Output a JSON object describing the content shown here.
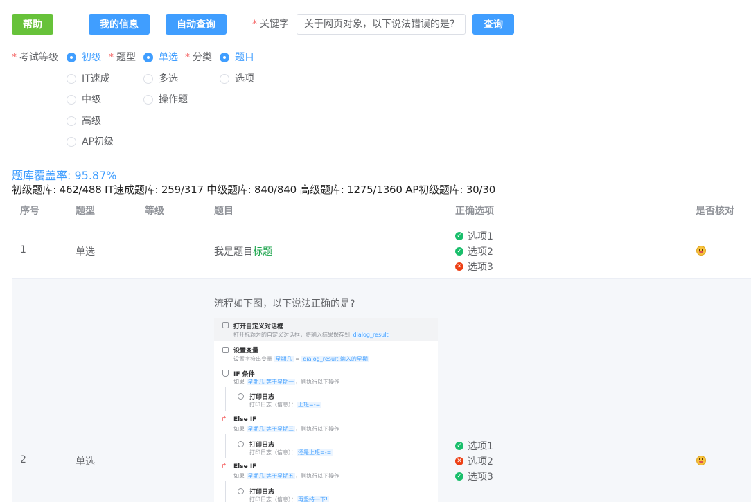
{
  "toolbar": {
    "help": "帮助",
    "my_info": "我的信息",
    "auto_query": "自动查询",
    "keyword_label": "关键字",
    "keyword_value": "关于网页对象，以下说法错误的是?",
    "query": "查询"
  },
  "filters": {
    "level_label": "考试等级",
    "levels": [
      "初级",
      "IT速成",
      "中级",
      "高级",
      "AP初级"
    ],
    "type_label": "题型",
    "types": [
      "单选",
      "多选",
      "操作题"
    ],
    "category_label": "分类",
    "categories": [
      "题目",
      "选项"
    ]
  },
  "coverage": "题库覆盖率: 95.87%",
  "stats": "初级题库: 462/488 IT速成题库: 259/317 中级题库: 840/840 高级题库: 1275/1360 AP初级题库: 30/30",
  "table": {
    "headers": [
      "序号",
      "题型",
      "等级",
      "题目",
      "正确选项",
      "是否核对"
    ],
    "rows": [
      {
        "index": "1",
        "type": "单选",
        "level": "",
        "question_prefix": "我是题目",
        "question_highlight": "标题",
        "options": [
          {
            "label": "选项1",
            "status": "correct"
          },
          {
            "label": "选项2",
            "status": "correct"
          },
          {
            "label": "选项3",
            "status": "wrong"
          }
        ]
      },
      {
        "index": "2",
        "type": "单选",
        "level": "",
        "question": "流程如下图，以下说法正确的是?",
        "options": [
          {
            "label": "选项1",
            "status": "correct"
          },
          {
            "label": "选项2",
            "status": "wrong"
          },
          {
            "label": "选项3",
            "status": "correct"
          }
        ],
        "flow": {
          "b1_title": "打开自定义对话框",
          "b1_sub": "打开标题为的自定义对话框，将输入结果保存到",
          "b1_var": "dialog_result",
          "b2_title": "设置变量",
          "b2_sub": "设置字符串变量",
          "b2_var": "星期几",
          "b2_eq": "=",
          "b2_val": "dialog_result.输入的星期",
          "b3_title": "IF 条件",
          "b3_sub_a": "如果",
          "b3_tag": "星期几 等于星期一",
          "b3_sub_b": "，则执行以下操作",
          "log1_title": "打印日志",
          "log1_sub": "打印日志（信息）：",
          "log1_val": "上班=-=",
          "b4_title": "Else IF",
          "b4_sub_a": "如果",
          "b4_tag": "星期几 等于星期三",
          "b4_sub_b": "，则执行以下操作",
          "log2_title": "打印日志",
          "log2_sub": "打印日志（信息）：",
          "log2_val": "还是上班=-=",
          "b5_title": "Else IF",
          "b5_sub_a": "如果",
          "b5_tag": "星期几 等于星期五",
          "b5_sub_b": "，则执行以下操作",
          "log3_title": "打印日志",
          "log3_sub": "打印日志（信息）：",
          "log3_val": "再坚持一下!"
        }
      }
    ]
  },
  "colors": {
    "primary": "#409eff",
    "success": "#67c23a",
    "required": "#f56c6c",
    "correct": "#19be6b",
    "wrong": "#ed3f14"
  }
}
